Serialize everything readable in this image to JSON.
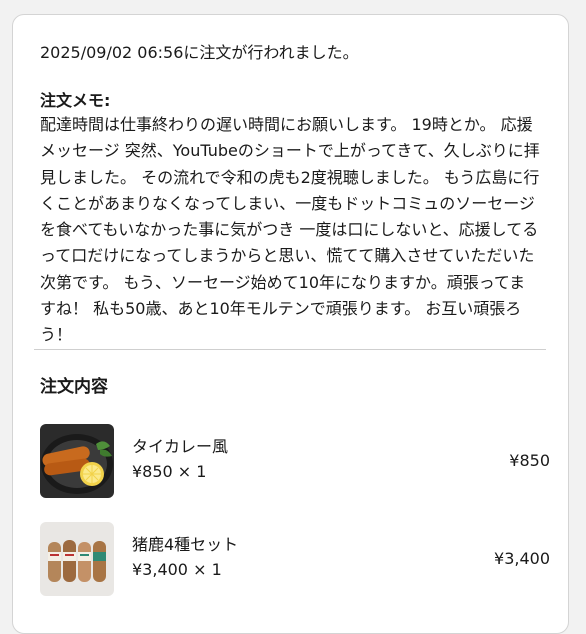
{
  "order": {
    "timestamp_text": "2025/09/02 06:56に注文が行われました。"
  },
  "memo": {
    "title": "注文メモ:",
    "body": "配達時間は仕事終わりの遅い時間にお願いします。 19時とか。 応援メッセージ 突然、YouTubeのショートで上がってきて、久しぶりに拝見しました。 その流れで令和の虎も2度視聴しました。 もう広島に行くことがあまりなくなってしまい、一度もドットコミュのソーセージを食べてもいなかった事に気がつき 一度は口にしないと、応援してるって口だけになってしまうからと思い、慌てて購入させていただいた次第です。 もう、ソーセージ始めて10年になりますか。頑張ってますね！ 私も50歳、あと10年モルテンで頑張ります。 お互い頑張ろう！"
  },
  "contents": {
    "title": "注文内容",
    "items": [
      {
        "name": "タイカレー風",
        "unit_qty": "¥850 × 1",
        "price": "¥850",
        "thumbnail": "sausage-dish-image"
      },
      {
        "name": "猪鹿4種セット",
        "unit_qty": "¥3,400 × 1",
        "price": "¥3,400",
        "thumbnail": "sausage-set-image"
      }
    ]
  }
}
